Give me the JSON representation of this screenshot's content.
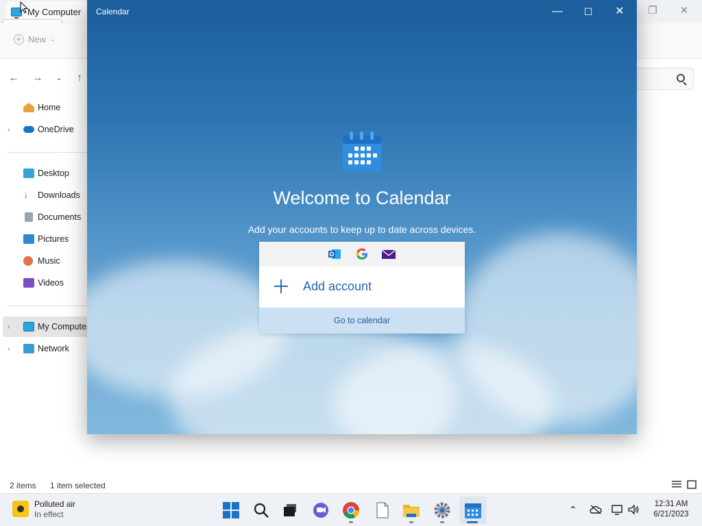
{
  "explorer": {
    "tab_title": "My Computer",
    "tooltip": "My Computer",
    "toolbar": {
      "new_label": "New"
    },
    "sidebar": [
      {
        "label": "Home",
        "icon": "home-icon",
        "chevron": false
      },
      {
        "label": "OneDrive",
        "icon": "onedrive-icon",
        "chevron": true
      },
      {
        "label": "Desktop",
        "icon": "desktop-icon",
        "chevron": false
      },
      {
        "label": "Downloads",
        "icon": "downloads-icon",
        "chevron": false
      },
      {
        "label": "Documents",
        "icon": "documents-icon",
        "chevron": false
      },
      {
        "label": "Pictures",
        "icon": "pictures-icon",
        "chevron": false
      },
      {
        "label": "Music",
        "icon": "music-icon",
        "chevron": false
      },
      {
        "label": "Videos",
        "icon": "videos-icon",
        "chevron": false
      },
      {
        "label": "My Computer",
        "icon": "computer-icon",
        "chevron": true,
        "selected": true
      },
      {
        "label": "Network",
        "icon": "network-icon",
        "chevron": true
      }
    ],
    "status": {
      "items": "2 items",
      "selected": "1 item selected"
    }
  },
  "calendar": {
    "title": "Calendar",
    "welcome": "Welcome to Calendar",
    "subtitle": "Add your accounts to keep up to date across devices.",
    "providers": [
      "outlook-icon",
      "google-icon",
      "mail-icon"
    ],
    "add_account": "Add account",
    "go_to_calendar": "Go to calendar",
    "accent": "#1f66b3"
  },
  "taskbar": {
    "weather_title": "Polluted air",
    "weather_sub": "In effect",
    "apps": [
      "start-icon",
      "search-icon",
      "task-view-icon",
      "chat-icon",
      "chrome-icon",
      "notepad-icon",
      "file-explorer-icon",
      "settings-icon",
      "calendar-icon"
    ],
    "time": "12:31 AM",
    "date": "6/21/2023"
  }
}
